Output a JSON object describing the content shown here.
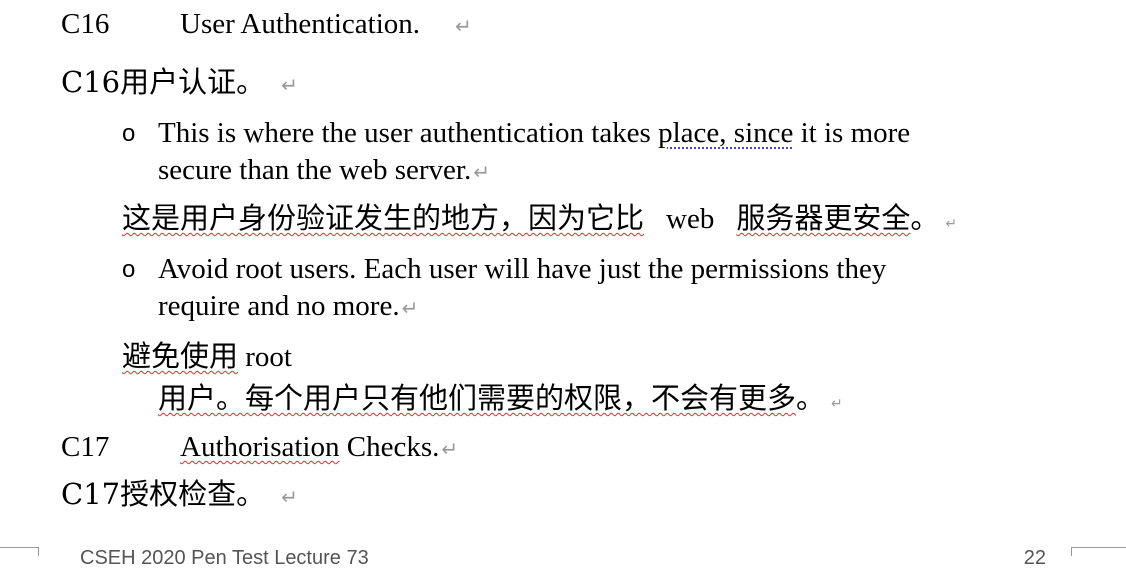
{
  "sections": {
    "c16": {
      "code": "C16",
      "title": "User Authentication.",
      "zh_heading": "C16用户认证。"
    },
    "c17": {
      "code": "C17",
      "title_underlined": "Authorisation",
      "title_rest": " Checks.",
      "zh_heading": "C17授权检查。"
    }
  },
  "bullets": {
    "b1": {
      "marker": "o",
      "line1_before": "This is where the user authentication takes ",
      "line1_dotted": "place, since",
      "line1_after": " it is more",
      "line2": "secure than the web server.",
      "zh_part1": "这是用户身份验证发生的地方，因为它比",
      "zh_web": "web",
      "zh_part2": "服务器更安全",
      "zh_end": "。"
    },
    "b2": {
      "marker": "o",
      "line1": "Avoid root users.  Each user will have just the permissions they",
      "line2": "require and no more.",
      "zh_line1_cn": "避免使用",
      "zh_line1_en": " root",
      "zh_line2": "用户。每个用户只有他们需要的权限，不会有更多",
      "zh_line2_end": "。"
    }
  },
  "marks": {
    "paragraph": "↵"
  },
  "footer": {
    "left": "CSEH 2020 Pen Test Lecture 73",
    "right": "22"
  }
}
